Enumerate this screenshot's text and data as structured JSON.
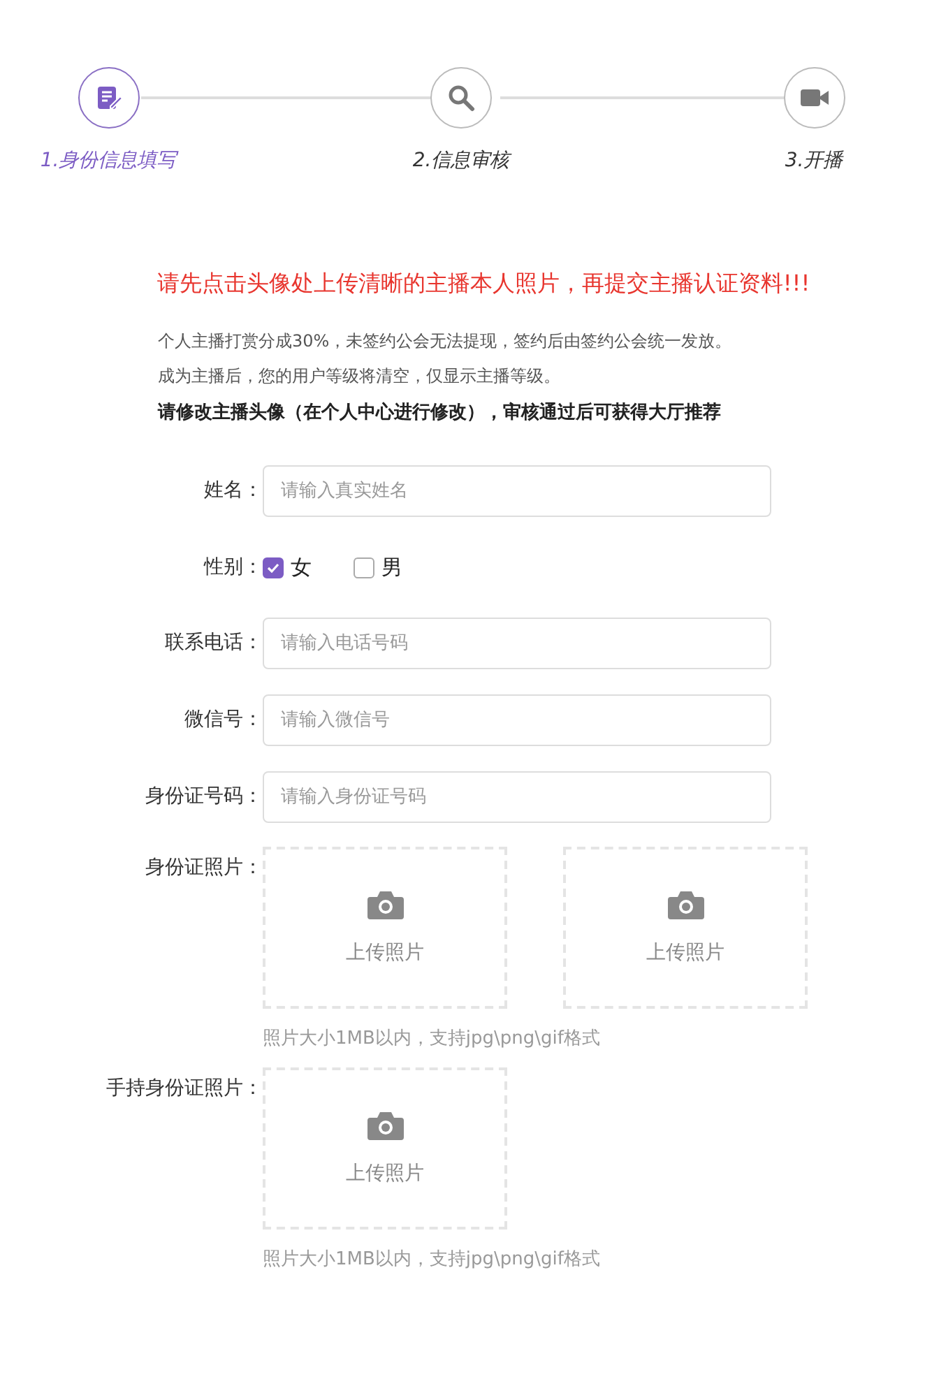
{
  "steps": [
    {
      "label": "1.身份信息填写",
      "active": true
    },
    {
      "label": "2.信息审核",
      "active": false
    },
    {
      "label": "3.开播",
      "active": false
    }
  ],
  "notice": "请先点击头像处上传清晰的主播本人照片，再提交主播认证资料!!!",
  "notes": [
    "个人主播打赏分成30%，未签约公会无法提现，签约后由签约公会统一发放。",
    "成为主播后，您的用户等级将清空，仅显示主播等级。"
  ],
  "avatar_note": "请修改主播头像（在个人中心进行修改），审核通过后可获得大厅推荐",
  "fields": [
    {
      "kind": "text",
      "label": "姓名：",
      "placeholder": "请输入真实姓名"
    },
    {
      "kind": "radio",
      "label": "性别：",
      "options": [
        {
          "label": "女",
          "selected": true
        },
        {
          "label": "男",
          "selected": false
        }
      ]
    },
    {
      "kind": "text",
      "label": "联系电话：",
      "placeholder": "请输入电话号码"
    },
    {
      "kind": "text",
      "label": "微信号：",
      "placeholder": "请输入微信号"
    },
    {
      "kind": "text",
      "label": "身份证号码：",
      "placeholder": "请输入身份证号码"
    },
    {
      "kind": "upload",
      "label": "身份证照片：",
      "slots": [
        "上传照片",
        "上传照片"
      ],
      "hint": "照片大小1MB以内，支持jpg\\png\\gif格式"
    },
    {
      "kind": "upload",
      "label": "手持身份证照片：",
      "slots": [
        "上传照片"
      ],
      "hint": "照片大小1MB以内，支持jpg\\png\\gif格式"
    }
  ]
}
